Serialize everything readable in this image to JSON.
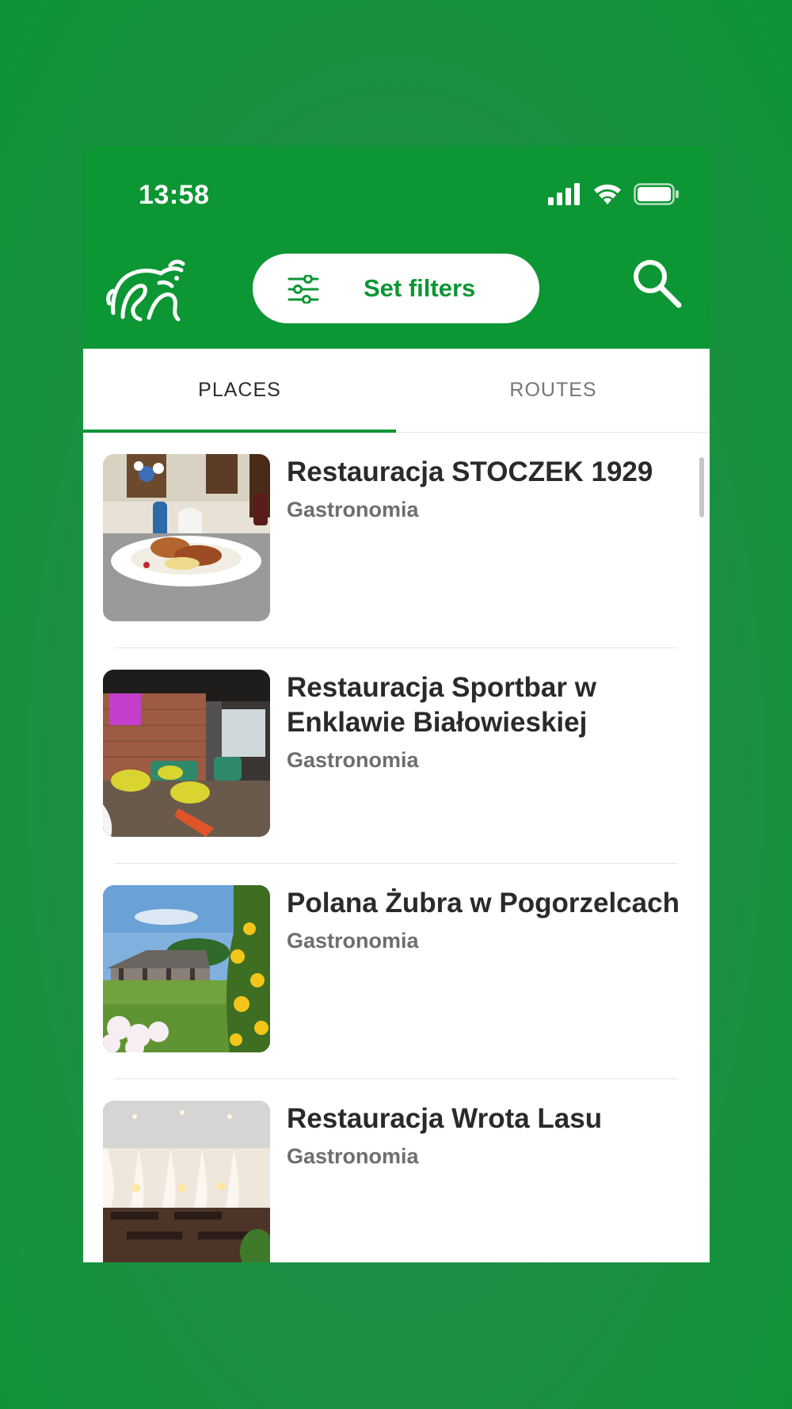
{
  "status_bar": {
    "time": "13:58",
    "icons": [
      "signal-icon",
      "wifi-icon",
      "battery-icon"
    ]
  },
  "header": {
    "logo": "bison-logo",
    "filter_button_label": "Set filters",
    "filter_icon": "sliders-icon",
    "search_icon": "search-icon"
  },
  "tabs": [
    {
      "label": "PLACES",
      "active": true
    },
    {
      "label": "ROUTES",
      "active": false
    }
  ],
  "places": [
    {
      "title": "Restauracja STOCZEK 1929",
      "category": "Gastronomia",
      "image": "restaurant-dish-photo"
    },
    {
      "title": "Restauracja Sportbar w Enklawie Białowieskiej",
      "category": "Gastronomia",
      "image": "sportbar-interior-photo"
    },
    {
      "title": "Polana Żubra w Pogorzelcach",
      "category": "Gastronomia",
      "image": "meadow-pavilion-photo"
    },
    {
      "title": "Restauracja Wrota Lasu",
      "category": "Gastronomia",
      "image": "dining-hall-photo"
    }
  ],
  "colors": {
    "brand_green": "#0c9634",
    "background_green": "#1f8f45",
    "title_text": "#2a2a2a",
    "category_text": "#6e6e6e"
  }
}
